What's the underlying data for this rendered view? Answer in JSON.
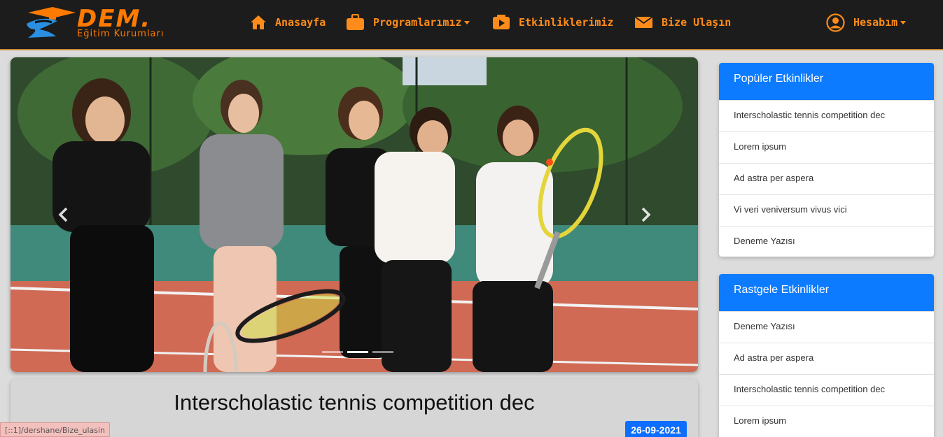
{
  "brand": {
    "name": "DEM.",
    "subtitle": "Eğitim Kurumları"
  },
  "nav": {
    "home": "Anasayfa",
    "programs": "Programlarımız",
    "events": "Etkinliklerimiz",
    "contact": "Bize Ulaşın",
    "account": "Hesabım"
  },
  "icons": {
    "home": "home-icon",
    "programs": "briefcase-icon",
    "events": "video-icon",
    "contact": "envelope-icon",
    "account": "user-circle-icon"
  },
  "colors": {
    "accent": "#ff8c1a",
    "navbar": "#1c1c1c",
    "primary": "#0d7bff"
  },
  "carousel": {
    "slide_count": 3,
    "active_slide": 1
  },
  "article": {
    "title": "Interscholastic tennis competition dec",
    "date": "26-09-2021"
  },
  "popular": {
    "title": "Popüler Etkinlikler",
    "items": [
      "Interscholastic tennis competition dec",
      "Lorem ipsum",
      "Ad astra per aspera",
      "Vi veri veniversum vivus vici",
      "Deneme Yazısı"
    ]
  },
  "random": {
    "title": "Rastgele Etkinlikler",
    "items": [
      "Deneme Yazısı",
      "Ad astra per aspera",
      "Interscholastic tennis competition dec",
      "Lorem ipsum"
    ]
  },
  "status_url": "[::1]/dershane/Bize_ulasin"
}
